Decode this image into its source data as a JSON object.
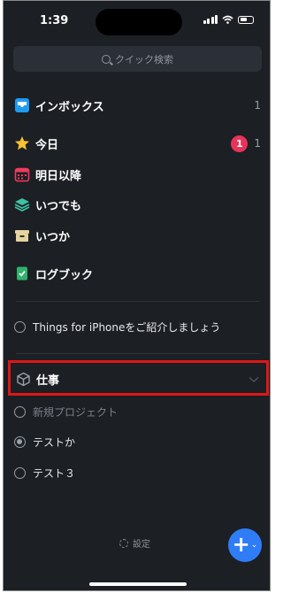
{
  "status": {
    "time": "1:39"
  },
  "search": {
    "placeholder": "クイック検索"
  },
  "nav": {
    "inbox": {
      "label": "インボックス",
      "count": "1"
    },
    "today": {
      "label": "今日",
      "badge": "1",
      "count": "1"
    },
    "upcoming": {
      "label": "明日以降"
    },
    "anytime": {
      "label": "いつでも"
    },
    "someday": {
      "label": "いつか"
    },
    "logbook": {
      "label": "ログブック"
    }
  },
  "intro_project": {
    "label": "Things for iPhoneをご紹介しましょう"
  },
  "area": {
    "label": "仕事",
    "projects": [
      {
        "label": "新規プロジェクト"
      },
      {
        "label": "テストか"
      },
      {
        "label": "テスト３"
      }
    ]
  },
  "footer": {
    "settings_label": "設定"
  },
  "colors": {
    "accent": "#2f7df6",
    "badge": "#e8335b",
    "highlight": "#e01616"
  }
}
